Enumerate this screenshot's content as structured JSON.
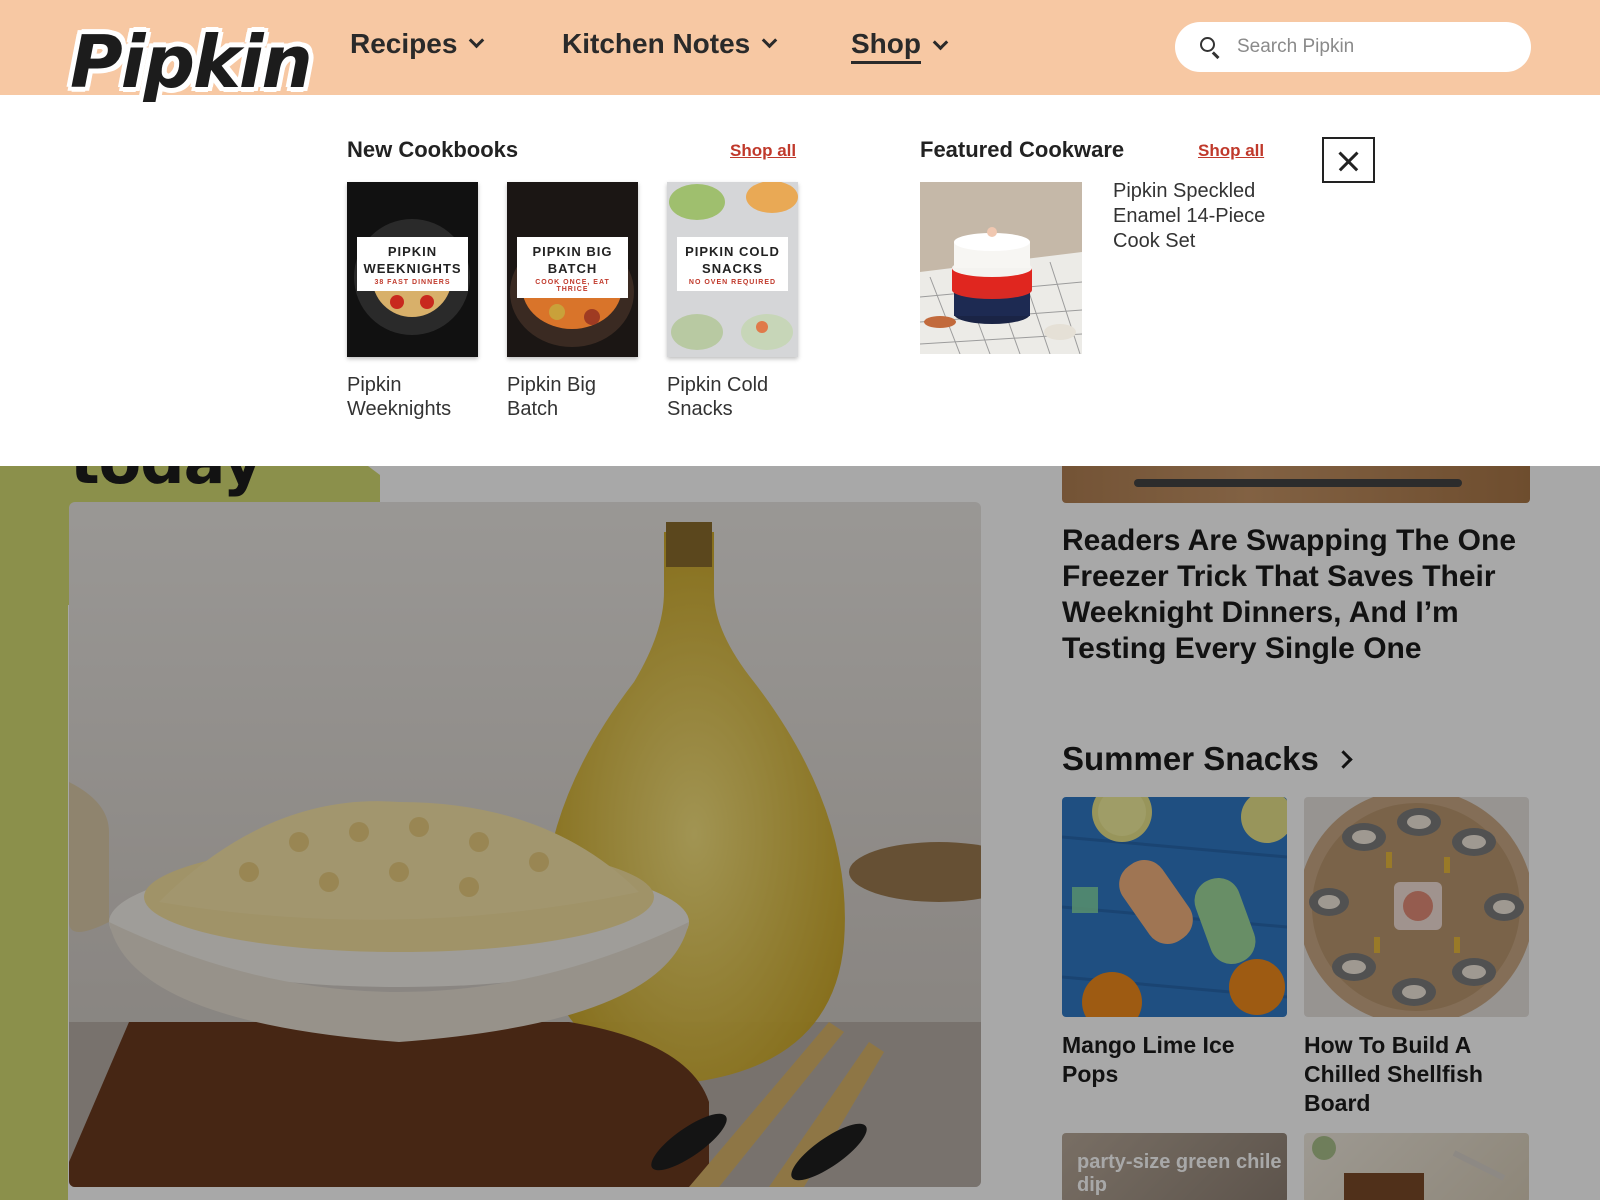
{
  "header": {
    "logo": "Pipkin",
    "nav": [
      {
        "label": "Recipes"
      },
      {
        "label": "Kitchen Notes"
      },
      {
        "label": "Shop"
      }
    ],
    "search_placeholder": "Search Pipkin"
  },
  "menu": {
    "cookbooks": {
      "heading": "New Cookbooks",
      "shop_all": "Shop all",
      "items": [
        {
          "title": "Pipkin Weeknights",
          "cover_title": "PIPKIN WEEKNIGHTS",
          "cover_subtitle": "38 FAST DINNERS"
        },
        {
          "title": "Pipkin Big Batch",
          "cover_title": "PIPKIN BIG BATCH",
          "cover_subtitle": "COOK ONCE, EAT THRICE"
        },
        {
          "title": "Pipkin Cold Snacks",
          "cover_title": "PIPKIN COLD SNACKS",
          "cover_subtitle": "NO OVEN REQUIRED"
        }
      ]
    },
    "cookware": {
      "heading": "Featured Cookware",
      "shop_all": "Shop all",
      "item": {
        "title": "Pipkin Speckled Enamel 14-Piece Cook Set"
      }
    }
  },
  "page": {
    "hero_word": "today",
    "article_title": "Readers Are Swapping The One Freezer Trick That Saves Their Weeknight Dinners, And I’m Testing Every Single One",
    "section": {
      "title": "Summer Snacks",
      "cards": [
        {
          "title": "Mango Lime Ice Pops"
        },
        {
          "title": "How To Build A Chilled Shellfish Board"
        },
        {
          "overlay": "party-size green chile dip"
        }
      ]
    }
  },
  "colors": {
    "header_bg": "#f7c8a3",
    "accent_green": "#d4db73",
    "link_red": "#c0392b"
  }
}
